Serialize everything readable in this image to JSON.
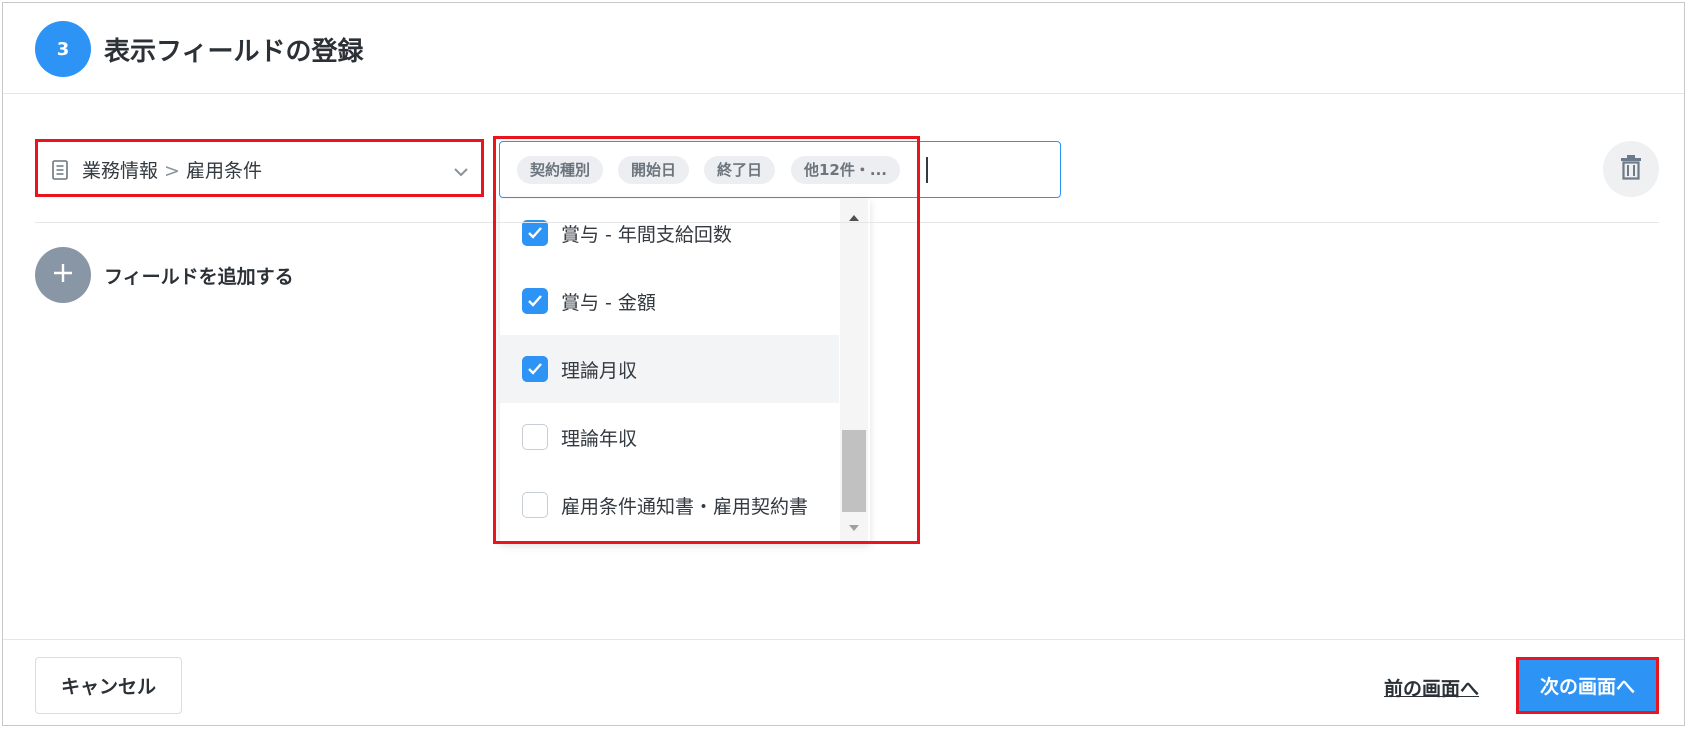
{
  "header": {
    "step_number": "3",
    "title": "表示フィールドの登録"
  },
  "category": {
    "parent": "業務情報",
    "child": "雇用条件",
    "separator": ">"
  },
  "fields": {
    "selected_chips": [
      "契約種別",
      "開始日",
      "終了日",
      "他12件・..."
    ],
    "dropdown_options": [
      {
        "label": "賞与 - 年間支給回数",
        "checked": true
      },
      {
        "label": "賞与 - 金額",
        "checked": true
      },
      {
        "label": "理論月収",
        "checked": true
      },
      {
        "label": "理論年収",
        "checked": false
      },
      {
        "label": "雇用条件通知書・雇用契約書",
        "checked": false
      }
    ]
  },
  "add_field": {
    "label": "フィールドを追加する"
  },
  "footer": {
    "cancel_label": "キャンセル",
    "prev_label": "前の画面へ",
    "next_label": "次の画面へ"
  },
  "colors": {
    "accent": "#2d93f5",
    "annotation": "#e8151f",
    "add_button": "#8896a6"
  }
}
